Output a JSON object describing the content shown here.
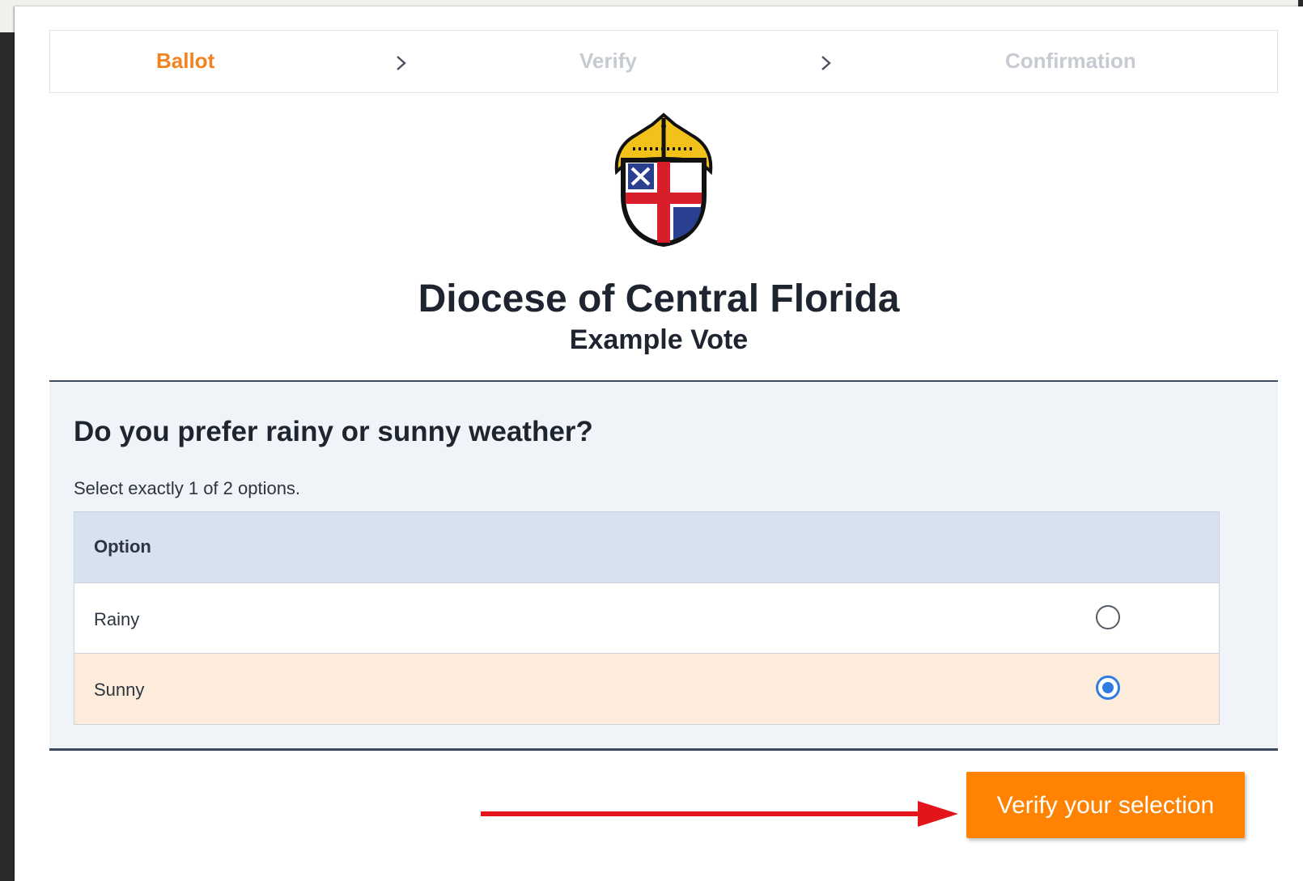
{
  "steps": [
    {
      "label": "Ballot",
      "state": "active"
    },
    {
      "label": "Verify",
      "state": "inactive"
    },
    {
      "label": "Confirmation",
      "state": "inactive"
    }
  ],
  "header": {
    "org_name": "Diocese of Central Florida",
    "vote_name": "Example Vote"
  },
  "question": {
    "title": "Do you prefer rainy or sunny weather?",
    "instructions": "Select exactly 1 of 2 options.",
    "column_header": "Option",
    "options": [
      {
        "label": "Rainy",
        "selected": false
      },
      {
        "label": "Sunny",
        "selected": true
      }
    ]
  },
  "actions": {
    "verify_label": "Verify your selection"
  },
  "colors": {
    "accent": "#ff8200",
    "active_step": "#f58220",
    "selected_row": "#fdebdb",
    "radio_selected": "#2f7de1",
    "annotation_arrow": "#e3141a"
  }
}
